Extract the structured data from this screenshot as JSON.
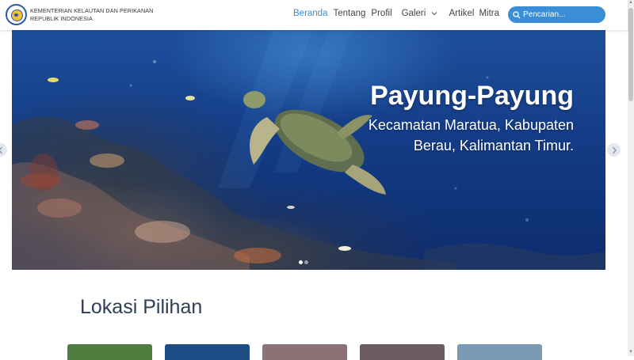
{
  "brand": {
    "line1": "KEMENTERIAN KELAUTAN DAN PERIKANAN",
    "line2": "REPUBLIK INDONESIA"
  },
  "nav": {
    "beranda": "Beranda",
    "tentang": "Tentang",
    "profil": "Profil",
    "galeri": "Galeri",
    "artikel": "Artikel",
    "mitra": "Mitra"
  },
  "search": {
    "placeholder": "Pencarian..."
  },
  "hero": {
    "title": "Payung-Payung",
    "subtitle": "Kecamatan Maratua, Kabupaten Berau, Kalimantan Timur."
  },
  "carousel": {
    "slide_count": 2,
    "active_slide": 1
  },
  "section": {
    "title": "Lokasi Pilihan"
  },
  "colors": {
    "accent": "#3a8ed6",
    "heading": "#2d3e55"
  }
}
